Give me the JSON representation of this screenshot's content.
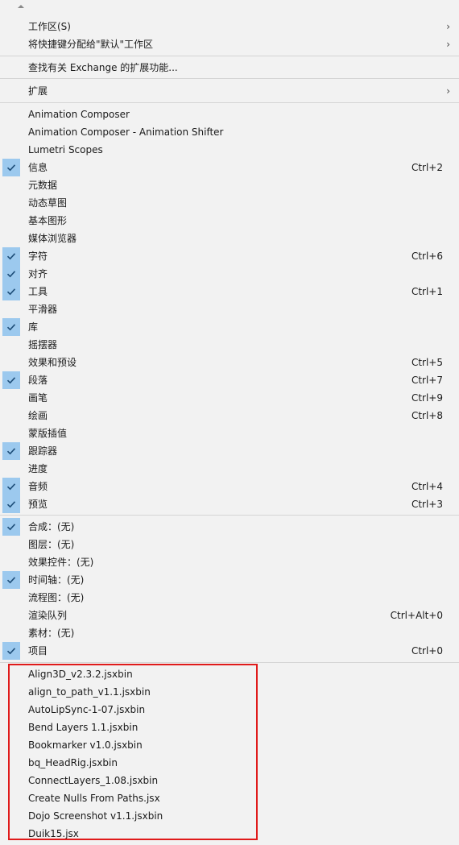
{
  "menu": {
    "group1": [
      {
        "label": "工作区(S)",
        "submenu": true
      },
      {
        "label": "将快捷键分配给\"默认\"工作区",
        "submenu": true
      }
    ],
    "exchange": {
      "label": "查找有关 Exchange 的扩展功能..."
    },
    "extensions": {
      "label": "扩展",
      "submenu": true
    },
    "panels": [
      {
        "label": "Animation Composer",
        "checked": false,
        "shortcut": ""
      },
      {
        "label": "Animation Composer - Animation Shifter",
        "checked": false,
        "shortcut": ""
      },
      {
        "label": "Lumetri Scopes",
        "checked": false,
        "shortcut": ""
      },
      {
        "label": "信息",
        "checked": true,
        "shortcut": "Ctrl+2"
      },
      {
        "label": "元数据",
        "checked": false,
        "shortcut": ""
      },
      {
        "label": "动态草图",
        "checked": false,
        "shortcut": ""
      },
      {
        "label": "基本图形",
        "checked": false,
        "shortcut": ""
      },
      {
        "label": "媒体浏览器",
        "checked": false,
        "shortcut": ""
      },
      {
        "label": "字符",
        "checked": true,
        "shortcut": "Ctrl+6"
      },
      {
        "label": "对齐",
        "checked": true,
        "shortcut": ""
      },
      {
        "label": "工具",
        "checked": true,
        "shortcut": "Ctrl+1"
      },
      {
        "label": "平滑器",
        "checked": false,
        "shortcut": ""
      },
      {
        "label": "库",
        "checked": true,
        "shortcut": ""
      },
      {
        "label": "摇摆器",
        "checked": false,
        "shortcut": ""
      },
      {
        "label": "效果和预设",
        "checked": false,
        "shortcut": "Ctrl+5"
      },
      {
        "label": "段落",
        "checked": true,
        "shortcut": "Ctrl+7"
      },
      {
        "label": "画笔",
        "checked": false,
        "shortcut": "Ctrl+9"
      },
      {
        "label": "绘画",
        "checked": false,
        "shortcut": "Ctrl+8"
      },
      {
        "label": "蒙版插值",
        "checked": false,
        "shortcut": ""
      },
      {
        "label": "跟踪器",
        "checked": true,
        "shortcut": ""
      },
      {
        "label": "进度",
        "checked": false,
        "shortcut": ""
      },
      {
        "label": "音频",
        "checked": true,
        "shortcut": "Ctrl+4"
      },
      {
        "label": "预览",
        "checked": true,
        "shortcut": "Ctrl+3"
      }
    ],
    "viewers": [
      {
        "label": "合成：(无)",
        "checked": true,
        "shortcut": ""
      },
      {
        "label": "图层：(无)",
        "checked": false,
        "shortcut": ""
      },
      {
        "label": "效果控件：(无)",
        "checked": false,
        "shortcut": ""
      },
      {
        "label": "时间轴：(无)",
        "checked": true,
        "shortcut": ""
      },
      {
        "label": "流程图：(无)",
        "checked": false,
        "shortcut": ""
      },
      {
        "label": "渲染队列",
        "checked": false,
        "shortcut": "Ctrl+Alt+0"
      },
      {
        "label": "素材：(无)",
        "checked": false,
        "shortcut": ""
      },
      {
        "label": "项目",
        "checked": true,
        "shortcut": "Ctrl+0"
      }
    ],
    "scripts": [
      {
        "label": "Align3D_v2.3.2.jsxbin"
      },
      {
        "label": "align_to_path_v1.1.jsxbin"
      },
      {
        "label": "AutoLipSync-1-07.jsxbin"
      },
      {
        "label": "Bend Layers 1.1.jsxbin"
      },
      {
        "label": "Bookmarker v1.0.jsxbin"
      },
      {
        "label": "bq_HeadRig.jsxbin"
      },
      {
        "label": "ConnectLayers_1.08.jsxbin"
      },
      {
        "label": "Create Nulls From Paths.jsx"
      },
      {
        "label": "Dojo Screenshot v1.1.jsxbin"
      },
      {
        "label": "Duik15.jsx"
      }
    ]
  },
  "colors": {
    "check_bg": "#9cc9ee",
    "highlight_border": "#e01b1b"
  }
}
